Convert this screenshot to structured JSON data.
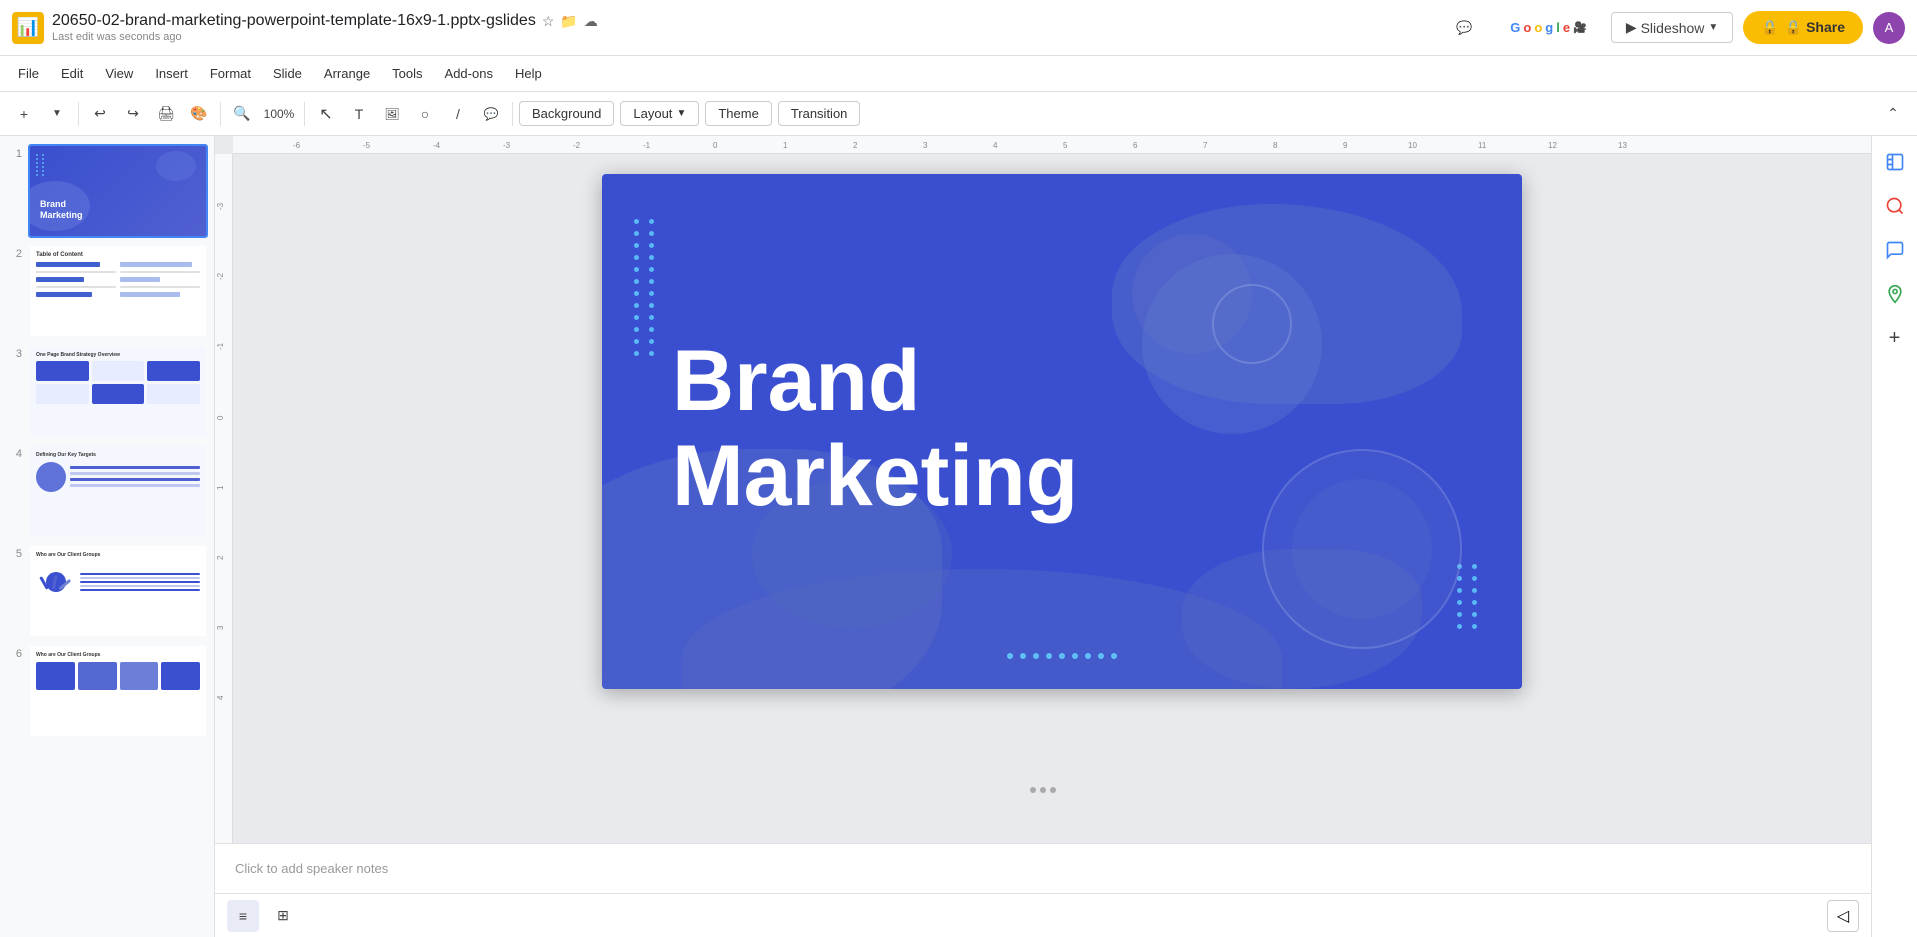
{
  "app": {
    "icon": "📊",
    "title": "20650-02-brand-marketing-powerpoint-template-16x9-1.pptx-gslides",
    "last_edit": "Last edit was seconds ago"
  },
  "header_actions": {
    "comment_icon": "💬",
    "meet_icon": "🎥",
    "slideshow_label": "Slideshow",
    "share_label": "🔒 Share",
    "avatar_initials": "A"
  },
  "menu": {
    "items": [
      "File",
      "Edit",
      "View",
      "Insert",
      "Format",
      "Slide",
      "Arrange",
      "Tools",
      "Add-ons",
      "Help"
    ]
  },
  "toolbar": {
    "background_label": "Background",
    "layout_label": "Layout",
    "theme_label": "Theme",
    "transition_label": "Transition"
  },
  "slide_panel": {
    "slides": [
      {
        "number": "1",
        "title": "Brand Marketing"
      },
      {
        "number": "2",
        "title": "Table of Content"
      },
      {
        "number": "3",
        "title": "One Page Brand Strategy Overview"
      },
      {
        "number": "4",
        "title": "Defining Our Key Targets"
      },
      {
        "number": "5",
        "title": "Who are Our Client Groups"
      },
      {
        "number": "6",
        "title": "Who are Our Client Groups"
      }
    ]
  },
  "slide": {
    "title_line1": "Brand",
    "title_line2": "Marketing",
    "bg_color": "#3a4fcf"
  },
  "notes": {
    "placeholder": "Click to add speaker notes"
  },
  "bottom_toolbar": {
    "grid_view_label": "Grid view",
    "filmstrip_label": "Filmstrip"
  }
}
